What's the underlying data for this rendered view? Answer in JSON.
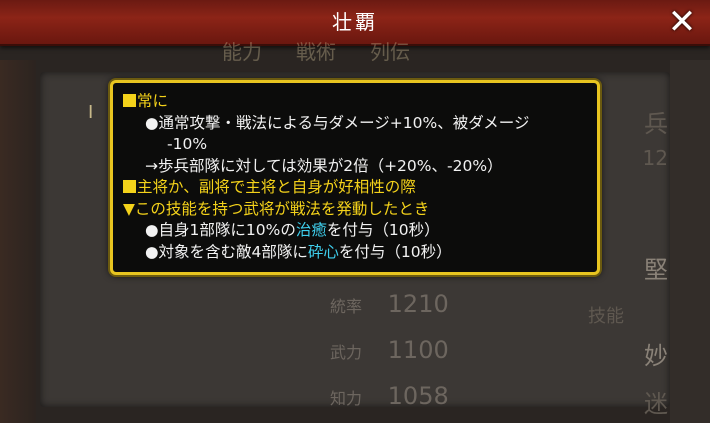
{
  "window": {
    "title": "壮覇"
  },
  "background": {
    "tabs": [
      "能力",
      "戦術",
      "列伝"
    ],
    "stats": [
      {
        "label": "統率",
        "value": "1210"
      },
      {
        "label": "武力",
        "value": "1100"
      },
      {
        "label": "知力",
        "value": "1058"
      }
    ],
    "right_labels": [
      "兵",
      "12",
      "堅",
      "技能",
      "妙",
      "迷"
    ],
    "section_marker": "I"
  },
  "tooltip": {
    "h1": "常に",
    "l1": "●通常攻撃・戦法による与ダメージ+10%、被ダメージ",
    "l2": "-10%",
    "l3": "→歩兵部隊に対しては効果が2倍（+20%、-20%）",
    "h2": "主将か、副将で主将と自身が好相性の際",
    "h3": "▼この技能を持つ武将が戦法を発動したとき",
    "l4_a": "●自身1部隊に10%の",
    "l4_kw": "治癒",
    "l4_b": "を付与（10秒）",
    "l5_a": "●対象を含む敵4部隊に",
    "l5_kw": "砕心",
    "l5_b": "を付与（10秒）"
  },
  "colors": {
    "accent": "#f4d21a",
    "keyword": "#3fd0ef",
    "border": "#e8c520"
  }
}
